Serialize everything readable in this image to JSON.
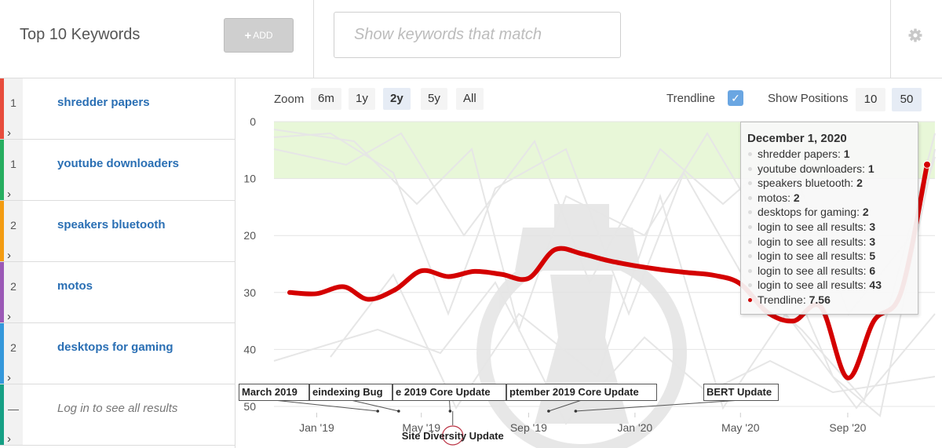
{
  "header": {
    "title": "Top 10 Keywords",
    "add_label": "ADD",
    "search_placeholder": "Show keywords that match"
  },
  "keywords": [
    {
      "rank": "1",
      "label": "shredder papers",
      "color": "#e74c3c"
    },
    {
      "rank": "1",
      "label": "youtube downloaders",
      "color": "#27ae60"
    },
    {
      "rank": "2",
      "label": "speakers bluetooth",
      "color": "#f39c12"
    },
    {
      "rank": "2",
      "label": "motos",
      "color": "#9b59b6"
    },
    {
      "rank": "2",
      "label": "desktops for gaming",
      "color": "#3498db"
    },
    {
      "rank": "—",
      "label": "Log in to see all results",
      "color": "#16a085"
    }
  ],
  "toolbar": {
    "zoom_label": "Zoom",
    "zoom_options": [
      "6m",
      "1y",
      "2y",
      "5y",
      "All"
    ],
    "zoom_active": "2y",
    "trendline_label": "Trendline",
    "trendline_checked": true,
    "positions_label": "Show Positions",
    "positions_options": [
      "10",
      "50"
    ],
    "positions_active": "50"
  },
  "tooltip": {
    "date": "December 1, 2020",
    "rows": [
      {
        "label": "shredder papers:",
        "value": "1"
      },
      {
        "label": "youtube downloaders:",
        "value": "1"
      },
      {
        "label": "speakers bluetooth:",
        "value": "2"
      },
      {
        "label": "motos:",
        "value": "2"
      },
      {
        "label": "desktops for gaming:",
        "value": "2"
      },
      {
        "label": "login to see all results:",
        "value": "3"
      },
      {
        "label": "login to see all results:",
        "value": "3"
      },
      {
        "label": "login to see all results:",
        "value": "5"
      },
      {
        "label": "login to see all results:",
        "value": "6"
      },
      {
        "label": "login to see all results:",
        "value": "43"
      },
      {
        "label": "Trendline:",
        "value": "7.56"
      }
    ]
  },
  "annotations": [
    {
      "label": "March 2019",
      "date": "2019-03-12"
    },
    {
      "label": "eindexing Bug",
      "date": "2019-04-05"
    },
    {
      "label": "e 2019 Core Update",
      "date": "2019-06-03"
    },
    {
      "label": "ptember 2019 Core Update",
      "date": "2019-09-24"
    },
    {
      "label": "BERT Update",
      "date": "2019-10-25"
    },
    {
      "label": "Site Diversity Update",
      "date": "2019-06-06"
    }
  ],
  "chart_data": {
    "type": "line",
    "x_tick_labels": [
      "Jan '19",
      "May '19",
      "Sep '19",
      "Jan '20",
      "May '20",
      "Sep '20"
    ],
    "y_tick_labels": [
      "0",
      "10",
      "20",
      "30",
      "40",
      "50"
    ],
    "ylim": [
      0,
      50
    ],
    "y_reversed": true,
    "highlight_band": [
      0,
      10
    ],
    "colors": {
      "trendline": "#d40000",
      "band": "#e8f7d8",
      "background_lines": "#e6e6e6"
    },
    "series": [
      {
        "name": "Trendline",
        "x": [
          "2018-12-01",
          "2019-01-01",
          "2019-02-01",
          "2019-03-01",
          "2019-04-01",
          "2019-05-01",
          "2019-06-01",
          "2019-07-01",
          "2019-08-01",
          "2019-09-01",
          "2019-10-01",
          "2019-11-01",
          "2019-12-01",
          "2020-01-01",
          "2020-02-01",
          "2020-03-01",
          "2020-04-01",
          "2020-05-01",
          "2020-06-01",
          "2020-07-01",
          "2020-08-01",
          "2020-09-01",
          "2020-10-01",
          "2020-11-01",
          "2020-12-01"
        ],
        "values": [
          30,
          30.2,
          29,
          31.2,
          29.5,
          26.2,
          27.2,
          26.3,
          26.8,
          27.5,
          22.5,
          23.2,
          24.4,
          25.3,
          26.0,
          26.5,
          27.0,
          28.5,
          33.5,
          35.0,
          32.5,
          45.0,
          35.0,
          30.0,
          7.56
        ]
      }
    ]
  }
}
